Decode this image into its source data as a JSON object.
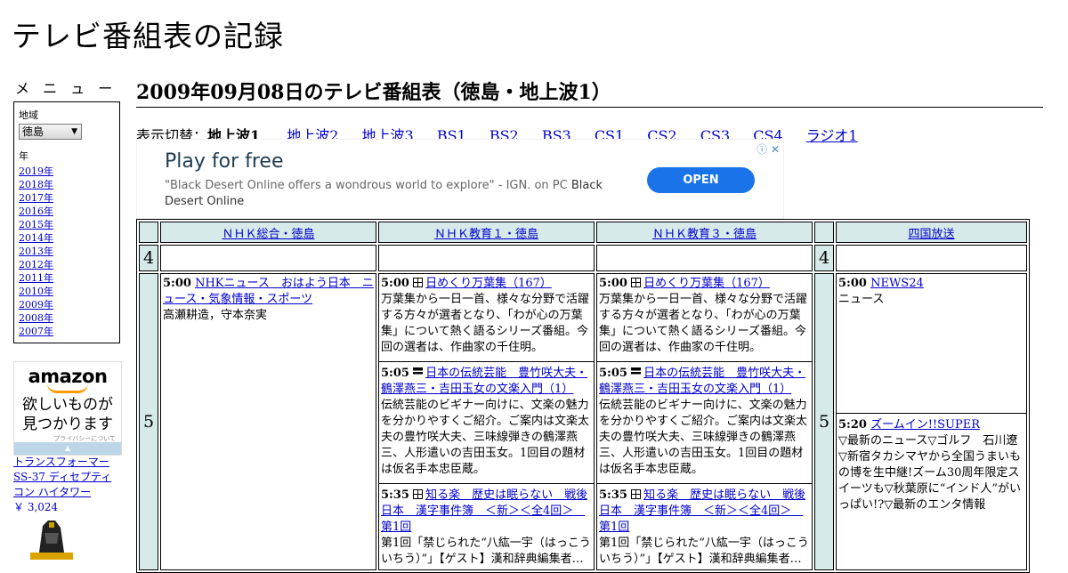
{
  "site": {
    "title": "テレビ番組表の記録"
  },
  "sidebar": {
    "menu_label": "メ ニ ュ ー",
    "region_label": "地域",
    "region_value": "徳島",
    "year_label": "年",
    "years": [
      "2019年",
      "2018年",
      "2017年",
      "2016年",
      "2015年",
      "2014年",
      "2013年",
      "2012年",
      "2011年",
      "2010年",
      "2009年",
      "2008年",
      "2007年"
    ]
  },
  "amazon_ad": {
    "logo": "amazon",
    "line1": "欲しいものが",
    "line2": "見つかります",
    "privacy": "プライバシーについて",
    "product": "トランスフォーマー SS-37 ディセプティコン ハイタワー",
    "price": "￥ 3,024"
  },
  "main": {
    "title": "2009年09月08日のテレビ番組表（徳島・地上波1）",
    "switch_label": "表示切替：",
    "current": "地上波1",
    "links": [
      "地上波2",
      "地上波3",
      "BS1",
      "BS2",
      "BS3",
      "CS1",
      "CS2",
      "CS3",
      "CS4",
      "ラジオ1"
    ]
  },
  "google_ad": {
    "title": "Play for free",
    "desc": "\"Black Desert Online offers a wondrous world to explore\" - IGN. on PC",
    "advertiser": "Black Desert Online",
    "button": "OPEN",
    "icons": "ⓘ ✕"
  },
  "grid": {
    "channels": [
      "ＮＨＫ総合・徳島",
      "ＮＨＫ教育１・徳島",
      "ＮＨＫ教育３・徳島",
      "四国放送"
    ],
    "hour4": "4",
    "hour5": "5",
    "nhk_sogo": {
      "time": "5:00",
      "title": "NHKニュース　おはよう日本　ニュース・気象情報・スポーツ",
      "desc": "高瀬耕造，守本奈実"
    },
    "edu1": [
      {
        "time": "5:00",
        "title": "日めくり万葉集（167）",
        "desc": "万葉集から一日一首、様々な分野で活躍する方々が選者となり、「わが心の万葉集」について熱く語るシリーズ番組。今回の選者は、作曲家の千住明。"
      },
      {
        "time": "5:05",
        "title": "日本の伝統芸能　豊竹咲大夫・鶴澤燕三・吉田玉女の文楽入門（1）",
        "desc": "伝統芸能のビギナー向けに、文楽の魅力を分かりやすくご紹介。ご案内は文楽太夫の豊竹咲大夫、三味線弾きの鶴澤燕三、人形遣いの吉田玉女。1回目の題材は仮名手本忠臣蔵。"
      },
      {
        "time": "5:35",
        "title": "知る楽　歴史は眠らない　戦後日本　漢字事件簿　＜新＞＜全4回＞　第1回",
        "desc": "第1回「禁じられた“八紘一宇（はっこういちう）”」【ゲスト】漢和辞典編集者…"
      }
    ],
    "edu3": [
      {
        "time": "5:00",
        "title": "日めくり万葉集（167）",
        "desc": "万葉集から一日一首、様々な分野で活躍する方々が選者となり、「わが心の万葉集」について熱く語るシリーズ番組。今回の選者は、作曲家の千住明。"
      },
      {
        "time": "5:05",
        "title": "日本の伝統芸能　豊竹咲大夫・鶴澤燕三・吉田玉女の文楽入門（1）",
        "desc": "伝統芸能のビギナー向けに、文楽の魅力を分かりやすくご紹介。ご案内は文楽太夫の豊竹咲大夫、三味線弾きの鶴澤燕三、人形遣いの吉田玉女。1回目の題材は仮名手本忠臣蔵。"
      },
      {
        "time": "5:35",
        "title": "知る楽　歴史は眠らない　戦後日本　漢字事件簿　＜新＞＜全4回＞　第1回",
        "desc": "第1回「禁じられた“八紘一宇（はっこういちう）”」【ゲスト】漢和辞典編集者…"
      }
    ],
    "shikoku": [
      {
        "time": "5:00",
        "title": "NEWS24",
        "desc": "ニュース"
      },
      {
        "time": "5:20",
        "title": "ズームイン!!SUPER",
        "desc": "▽最新のニュース▽ゴルフ　石川遼▽新宿タカシマヤから全国うまいもの博を生中継!ズーム30周年限定スイーツも▽秋葉原に“インド人”がいっぱい!?▽最新のエンタ情報"
      }
    ]
  }
}
